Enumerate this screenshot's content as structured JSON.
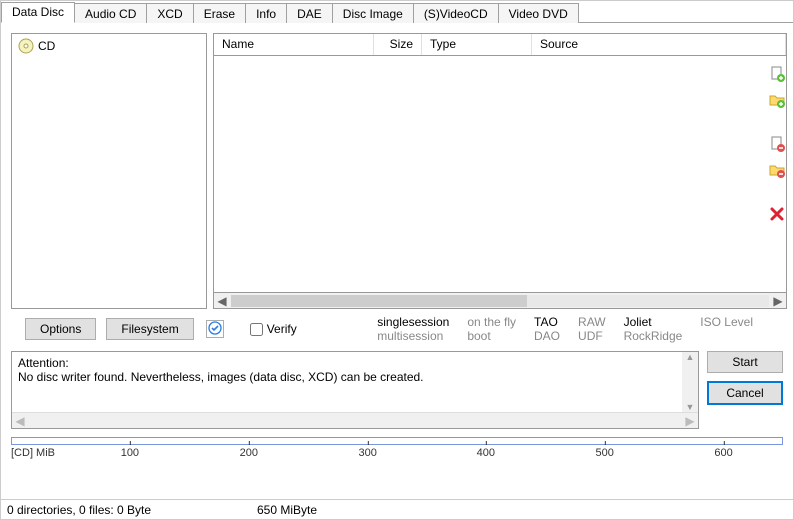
{
  "tabs": {
    "items": [
      {
        "label": "Data Disc",
        "active": true
      },
      {
        "label": "Audio CD"
      },
      {
        "label": "XCD"
      },
      {
        "label": "Erase"
      },
      {
        "label": "Info"
      },
      {
        "label": "DAE"
      },
      {
        "label": "Disc Image"
      },
      {
        "label": "(S)VideoCD"
      },
      {
        "label": "Video DVD"
      }
    ]
  },
  "tree": {
    "root_label": "CD"
  },
  "file_columns": {
    "name": "Name",
    "size": "Size",
    "type": "Type",
    "source": "Source"
  },
  "buttons": {
    "options": "Options",
    "filesystem": "Filesystem",
    "verify": "Verify",
    "start": "Start",
    "cancel": "Cancel"
  },
  "session_flags": {
    "singlesession": {
      "label": "singlesession",
      "active": true
    },
    "multisession": {
      "label": "multisession",
      "active": false
    },
    "on_the_fly": {
      "label": "on the fly",
      "active": false
    },
    "boot": {
      "label": "boot",
      "active": false
    },
    "tao": {
      "label": "TAO",
      "active": true
    },
    "dao": {
      "label": "DAO",
      "active": false
    },
    "raw": {
      "label": "RAW",
      "active": false
    },
    "udf": {
      "label": "UDF",
      "active": false
    },
    "joliet": {
      "label": "Joliet",
      "active": true
    },
    "rockridge": {
      "label": "RockRidge",
      "active": false
    },
    "isolevel": {
      "label": "ISO Level",
      "active": false
    }
  },
  "log": {
    "line1": "Attention:",
    "line2": "No disc writer found. Nevertheless, images (data disc, XCD) can be created."
  },
  "ruler": {
    "unit_label": "[CD] MiB",
    "ticks": [
      "100",
      "200",
      "300",
      "400",
      "500",
      "600"
    ]
  },
  "status": {
    "left": "0 directories, 0 files: 0 Byte",
    "right": "650 MiByte"
  },
  "side_icons": [
    "add-file-icon",
    "add-folder-icon",
    "remove-file-icon",
    "remove-folder-icon",
    "delete-icon"
  ]
}
